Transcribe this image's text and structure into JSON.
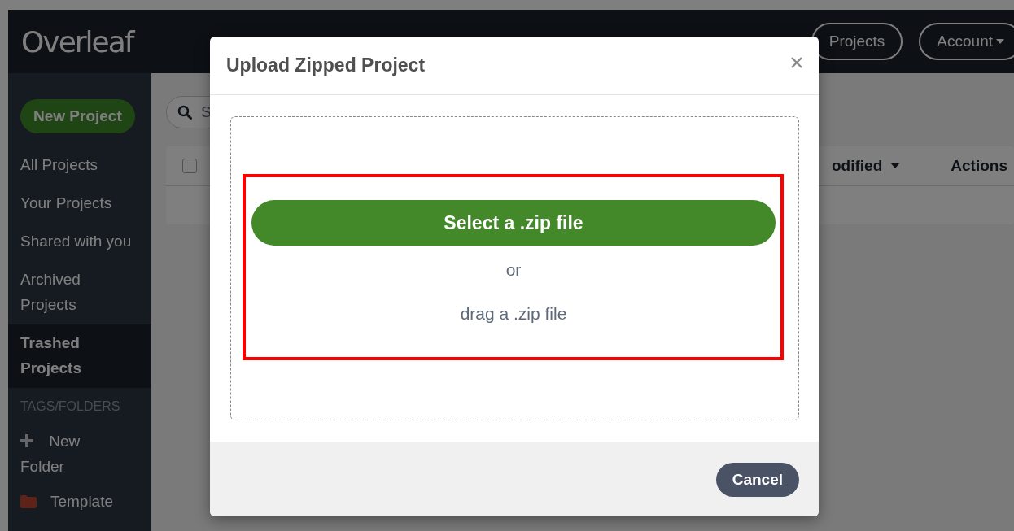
{
  "navbar": {
    "logo": "Overleaf",
    "buttons": [
      {
        "label": "Projects",
        "kind": "plain"
      },
      {
        "label": "Account",
        "kind": "dropdown"
      }
    ]
  },
  "sidebar": {
    "new_project": "New Project",
    "items": [
      {
        "label": "All Projects",
        "selected": false
      },
      {
        "label": "Your Projects",
        "selected": false
      },
      {
        "label": "Shared with you",
        "selected": false
      },
      {
        "label": "Archived Projects",
        "selected": false
      },
      {
        "label": "Trashed Projects",
        "selected": true
      }
    ],
    "section_title": "TAGS/FOLDERS",
    "folders": [
      {
        "label": "New Folder",
        "kind": "add"
      },
      {
        "label": "Template",
        "kind": "folder",
        "color": "#5e2219"
      }
    ]
  },
  "main": {
    "search": {
      "placeholder": "S"
    },
    "table": {
      "columns": [
        "odified",
        "Actions"
      ],
      "select_all": false
    }
  },
  "modal": {
    "title": "Upload Zipped Project",
    "select_button": "Select a .zip file",
    "separator": "or",
    "drop_hint": "drag a .zip file",
    "cancel": "Cancel"
  }
}
